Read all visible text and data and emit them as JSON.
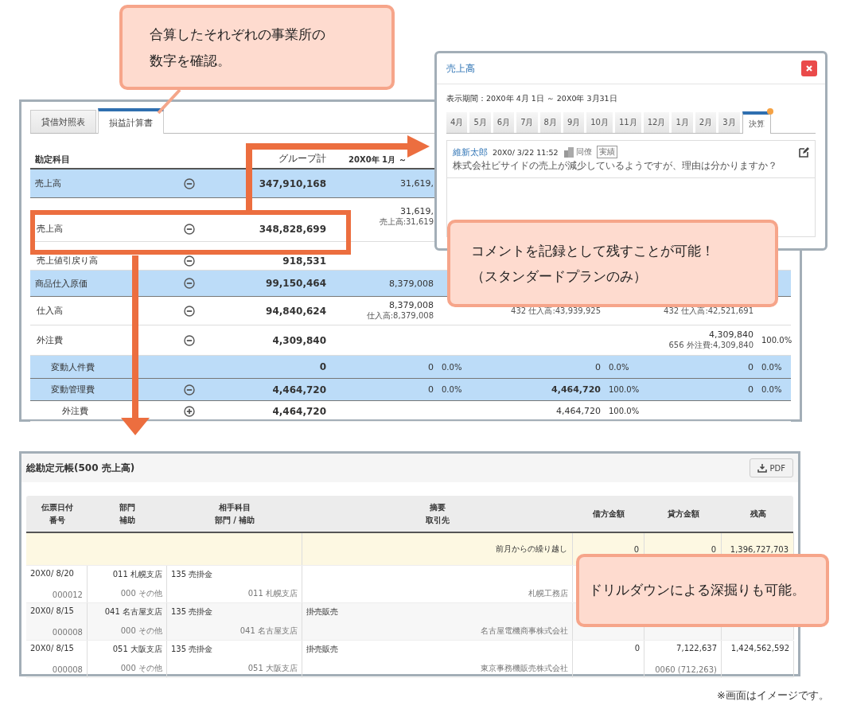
{
  "callouts": [
    {
      "lines": [
        "合算したそれぞれの事業所の",
        "数字を確認。"
      ]
    },
    {
      "lines": [
        "コメントを記録として残すことが可能！",
        "（スタンダードプランのみ）"
      ]
    },
    {
      "lines": [
        "ドリルダウンによる深掘りも可能。"
      ]
    }
  ],
  "statement": {
    "tabs": [
      {
        "label": "貸借対照表",
        "selected": false
      },
      {
        "label": "損益計算書",
        "selected": true
      }
    ],
    "columns": {
      "account": "勘定科目",
      "total": "グループ計",
      "period": "20X0年 1月 ～"
    },
    "rows": [
      {
        "name": "売上高",
        "kind": "total",
        "expanded": true,
        "total": "347,910,168",
        "cells": [
          {
            "value": "31,619,"
          },
          null,
          null
        ]
      },
      {
        "name": "売上高",
        "kind": "account",
        "expanded": true,
        "total": "348,828,699",
        "cells": [
          {
            "value": "31,619,",
            "sub": "売上高:31,619"
          },
          null,
          null
        ]
      },
      {
        "name": "売上値引戻り高",
        "kind": "account",
        "expanded": true,
        "total": "918,531",
        "cells": [
          null,
          null,
          null
        ]
      },
      {
        "name": "商品仕入原価",
        "kind": "total",
        "expanded": true,
        "total": "99,150,464",
        "cells": [
          {
            "value": "8,379,008"
          },
          null,
          null
        ]
      },
      {
        "name": "仕入高",
        "kind": "account",
        "expanded": true,
        "total": "94,840,624",
        "cells": [
          {
            "value": "8,379,008",
            "sub": "仕入高:8,379,008"
          },
          {
            "sub": "432 仕入高:43,939,925"
          },
          {
            "sub": "432 仕入高:42,521,691"
          }
        ]
      },
      {
        "name": "外注費",
        "kind": "account",
        "expanded": true,
        "total": "4,309,840",
        "cells": [
          null,
          null,
          {
            "value": "4,309,840",
            "sub": "656 外注費:4,309,840",
            "pct": "100.0%"
          }
        ]
      },
      {
        "name": "変動人件費",
        "kind": "variable",
        "total": "0",
        "cells": [
          {
            "value": "0",
            "pct": "0.0%"
          },
          {
            "value": "0",
            "pct": "0.0%"
          },
          {
            "value": "0",
            "pct": "0.0%"
          }
        ]
      },
      {
        "name": "変動管理費",
        "kind": "variable",
        "expanded": true,
        "total": "4,464,720",
        "cells": [
          {
            "value": "0",
            "pct": "0.0%"
          },
          {
            "value": "4,464,720",
            "pct": "100.0%",
            "bold": true
          },
          {
            "value": "0",
            "pct": "0.0%"
          }
        ]
      },
      {
        "name": "外注費",
        "kind": "detail",
        "expanded": false,
        "total": "4,464,720",
        "cells": [
          null,
          {
            "value": "4,464,720",
            "pct": "100.0%"
          },
          null
        ]
      }
    ]
  },
  "comment_popup": {
    "title": "売上高",
    "period": "表示期間：20X0年 4月 1日 ～ 20X0年 3月31日",
    "months": [
      {
        "label": "4月",
        "selected": false,
        "notified": false
      },
      {
        "label": "5月",
        "selected": false,
        "notified": false
      },
      {
        "label": "6月",
        "selected": false,
        "notified": false
      },
      {
        "label": "7月",
        "selected": false,
        "notified": false
      },
      {
        "label": "8月",
        "selected": false,
        "notified": false
      },
      {
        "label": "9月",
        "selected": false,
        "notified": false
      },
      {
        "label": "10月",
        "selected": false,
        "notified": false
      },
      {
        "label": "11月",
        "selected": false,
        "notified": false
      },
      {
        "label": "12月",
        "selected": false,
        "notified": false
      },
      {
        "label": "1月",
        "selected": false,
        "notified": false
      },
      {
        "label": "2月",
        "selected": false,
        "notified": false
      },
      {
        "label": "3月",
        "selected": false,
        "notified": false
      },
      {
        "label": "決算",
        "selected": true,
        "notified": true
      }
    ],
    "comment": {
      "author": "維新太郎",
      "time": "20X0/ 3/22 11:52",
      "group": "同僚",
      "tag": "実績",
      "text": "株式会社ビサイドの売上が減少しているようですが、理由は分かりますか？"
    }
  },
  "ledger": {
    "title": "総勘定元帳(500 売上高)",
    "pdf_label": "PDF",
    "columns": [
      [
        "伝票日付",
        "番号"
      ],
      [
        "部門",
        "補助"
      ],
      [
        "相手科目",
        "部門 / 補助"
      ],
      [
        "摘要",
        "取引先"
      ],
      [
        "借方金額"
      ],
      [
        "貸方金額"
      ],
      [
        "残高"
      ]
    ],
    "carry": {
      "label": "前月からの繰り越し",
      "debit": "0",
      "credit": "0",
      "balance": "1,396,727,703"
    },
    "rows": [
      {
        "date": "20X0/ 8/20",
        "number": "000012",
        "dept": "011 札幌支店",
        "sub": "000 その他",
        "counter": "135 売掛金",
        "counter_dept": "011 札幌支店",
        "partner": "札幌工務店"
      },
      {
        "date": "20X0/ 8/15",
        "number": "000008",
        "dept": "041 名古屋支店",
        "sub": "000 その他",
        "counter": "135 売掛金",
        "counter_dept": "041 名古屋支店",
        "summary": "掛売販売",
        "partner": "名古屋電機商事株式会社"
      },
      {
        "date": "20X0/ 8/15",
        "number": "000008",
        "dept": "051 大阪支店",
        "sub": "000 その他",
        "counter": "135 売掛金",
        "counter_dept": "051 大阪支店",
        "summary": "掛売販売",
        "partner": "東京事務機販売株式会社",
        "debit": "0",
        "credit": "7,122,637",
        "credit_sub": "0060 (712,263)",
        "balance": "1,424,562,592"
      }
    ]
  },
  "footnote": "※画面はイメージです。"
}
